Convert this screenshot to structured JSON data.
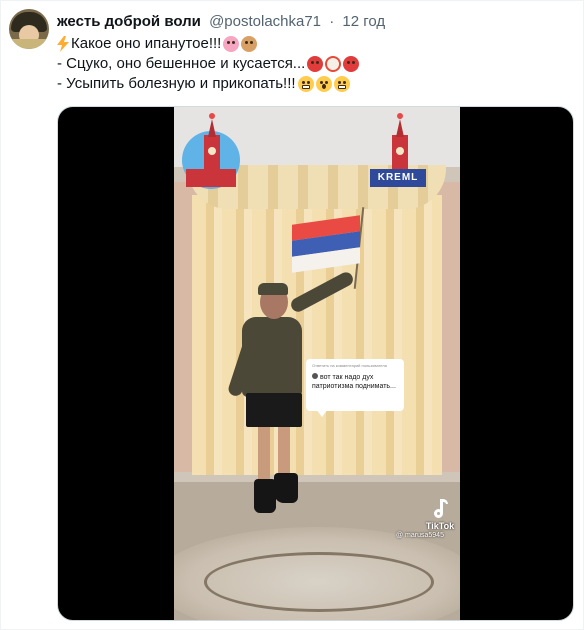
{
  "tweet": {
    "display_name": "жесть доброй воли",
    "handle": "@postolachka71",
    "separator": "·",
    "time": "12 год",
    "lines": [
      {
        "text": "Какое оно ипанутое!!!",
        "emojis": [
          "lightning-icon",
          "pig-face-emoji",
          "dog-face-emoji"
        ]
      },
      {
        "text": "- Сцуко, оно бешенное и кусается...",
        "emojis": [
          "rage-emoji",
          "clown-emoji",
          "rage-emoji"
        ]
      },
      {
        "text": "- Усыпить болезную и прикопать!!!",
        "emojis": [
          "grimace-emoji",
          "scream-emoji",
          "grimace-emoji"
        ]
      }
    ]
  },
  "media": {
    "kremlin_badge": "KREML",
    "comment": {
      "header": "Ответить на комментарий пользователя",
      "body": "вот так надо дух патриотизма поднимать..."
    },
    "watermark": {
      "brand": "TikTok",
      "user": "@ marusa5945"
    },
    "colors": {
      "flag": [
        "#e94a44",
        "#3f5fb4",
        "#f5f2ee"
      ],
      "kremlin_circle": "#5fb3e6",
      "kremlin_badge": "#2f4a9a"
    }
  }
}
